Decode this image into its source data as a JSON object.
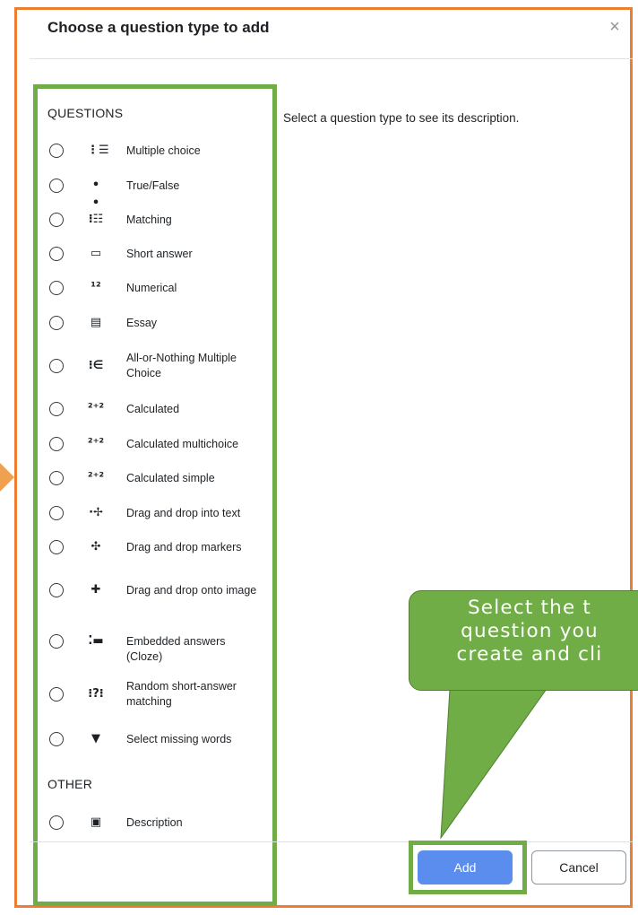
{
  "modal": {
    "title": "Choose a question type to add",
    "close_symbol": "×",
    "description_placeholder": "Select a question type to see its description."
  },
  "sections": {
    "questions_heading": "QUESTIONS",
    "other_heading": "OTHER"
  },
  "question_types": [
    {
      "label": "Multiple choice",
      "icon": "multiple-choice-icon",
      "glyph": "⋮☰"
    },
    {
      "label": "True/False",
      "icon": "true-false-icon",
      "glyph": "• •"
    },
    {
      "label": "Matching",
      "icon": "matching-icon",
      "glyph": "⁝☷"
    },
    {
      "label": "Short answer",
      "icon": "short-answer-icon",
      "glyph": "▭"
    },
    {
      "label": "Numerical",
      "icon": "numerical-icon",
      "glyph": "¹²"
    },
    {
      "label": "Essay",
      "icon": "essay-icon",
      "glyph": "▤"
    },
    {
      "label": "All-or-Nothing Multiple Choice",
      "icon": "all-or-nothing-icon",
      "glyph": "⁝∈"
    },
    {
      "label": "Calculated",
      "icon": "calculated-icon",
      "glyph": "²⁺²"
    },
    {
      "label": "Calculated multichoice",
      "icon": "calculated-multichoice-icon",
      "glyph": "²⁺²"
    },
    {
      "label": "Calculated simple",
      "icon": "calculated-simple-icon",
      "glyph": "²⁺²"
    },
    {
      "label": "Drag and drop into text",
      "icon": "drag-drop-text-icon",
      "glyph": "·✢"
    },
    {
      "label": "Drag and drop markers",
      "icon": "drag-drop-markers-icon",
      "glyph": "✣"
    },
    {
      "label": "Drag and drop onto image",
      "icon": "drag-drop-image-icon",
      "glyph": "✚"
    },
    {
      "label": "Embedded answers (Cloze)",
      "icon": "cloze-icon",
      "glyph": "⁚▬"
    },
    {
      "label": "Random short-answer matching",
      "icon": "random-short-answer-icon",
      "glyph": "⁝?⁝"
    },
    {
      "label": "Select missing words",
      "icon": "select-missing-words-icon",
      "glyph": "▼"
    }
  ],
  "other_types": [
    {
      "label": "Description",
      "icon": "description-icon",
      "glyph": "▣"
    }
  ],
  "footer": {
    "add_label": "Add",
    "cancel_label": "Cancel"
  },
  "callout": {
    "line1": "Select the t",
    "line2": "question you",
    "line3": "create and cli"
  },
  "colors": {
    "frame_border": "#ed7d31",
    "highlight_green": "#70ad47",
    "add_button": "#5b8def"
  }
}
